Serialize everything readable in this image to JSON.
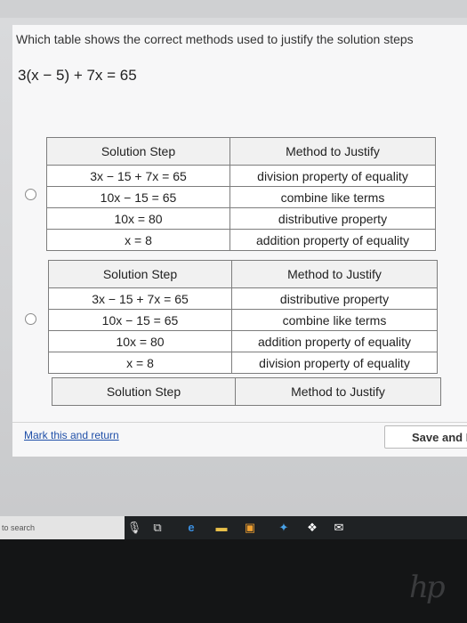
{
  "question": "Which table shows the correct methods used to justify the solution steps",
  "equation": "3(x − 5) + 7x = 65",
  "options": [
    {
      "header": {
        "step": "Solution Step",
        "method": "Method to Justify"
      },
      "rows": [
        {
          "step": "3x − 15 + 7x = 65",
          "method": "division property of equality"
        },
        {
          "step": "10x − 15 = 65",
          "method": "combine like terms"
        },
        {
          "step": "10x = 80",
          "method": "distributive property"
        },
        {
          "step": "x = 8",
          "method": "addition property of equality"
        }
      ]
    },
    {
      "header": {
        "step": "Solution Step",
        "method": "Method to Justify"
      },
      "rows": [
        {
          "step": "3x − 15 + 7x = 65",
          "method": "distributive property"
        },
        {
          "step": "10x − 15 = 65",
          "method": "combine like terms"
        },
        {
          "step": "10x = 80",
          "method": "addition property of equality"
        },
        {
          "step": "x = 8",
          "method": "division property of equality"
        }
      ]
    },
    {
      "header": {
        "step": "Solution Step",
        "method": "Method to Justify"
      }
    }
  ],
  "footer": {
    "mark_link": "Mark this and return",
    "save_label": "Save and E"
  },
  "taskbar": {
    "search_text": "to search",
    "icons": [
      "microphone-icon",
      "task-view-icon",
      "edge-icon",
      "file-explorer-icon",
      "store-icon",
      "pinned-app-icon",
      "dropbox-icon",
      "mail-icon"
    ]
  },
  "brand": "hp"
}
